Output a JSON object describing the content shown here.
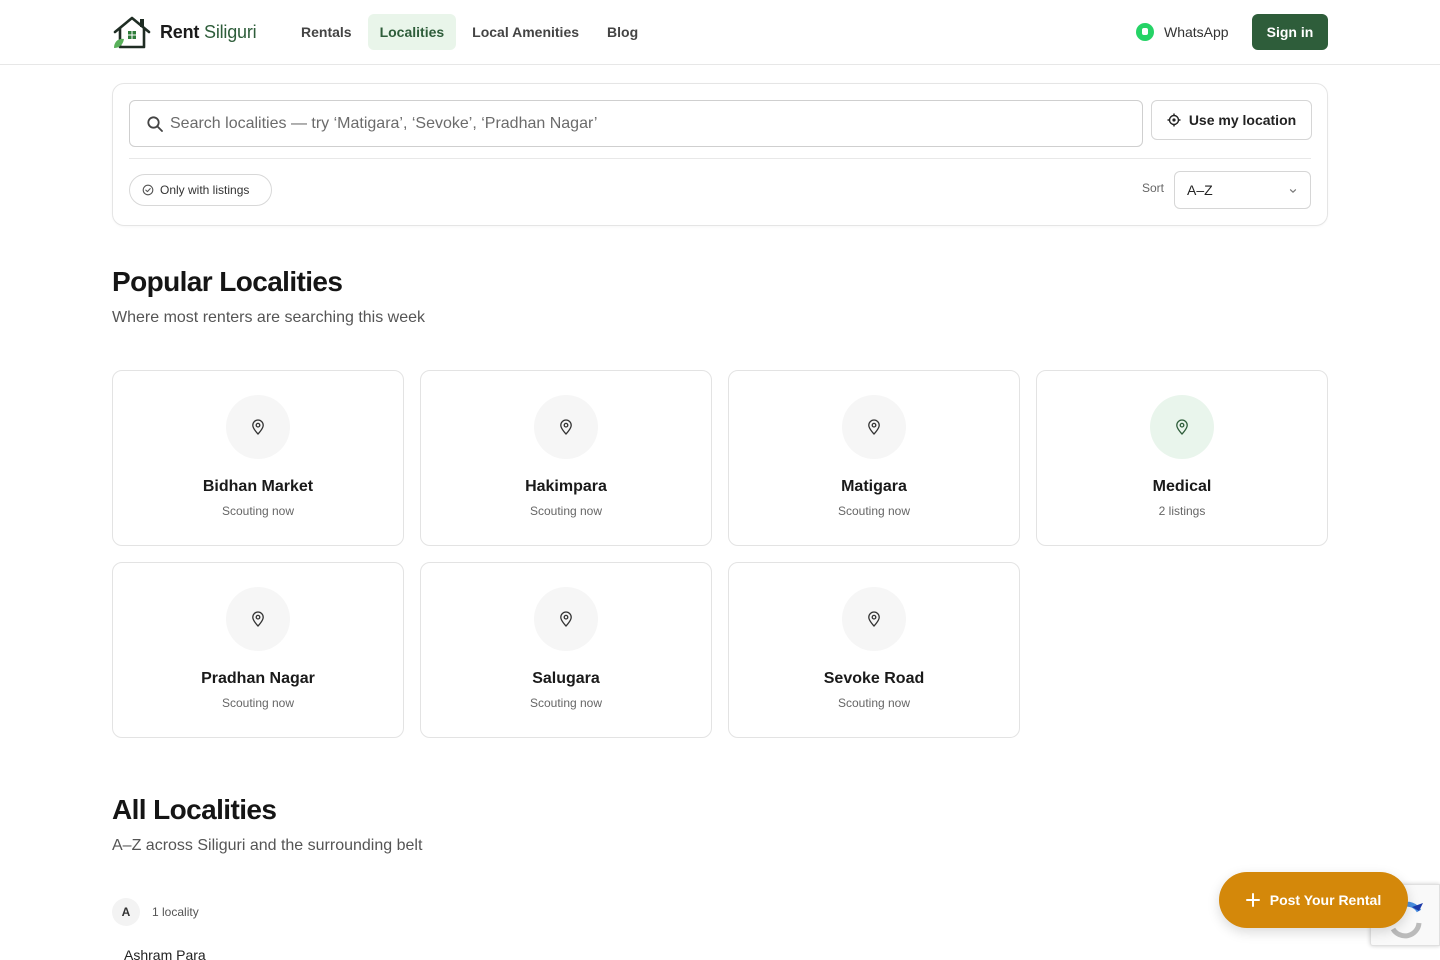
{
  "header": {
    "brand_main": "Rent",
    "brand_accent": "Siliguri",
    "nav": [
      {
        "label": "Rentals",
        "active": false
      },
      {
        "label": "Localities",
        "active": true
      },
      {
        "label": "Local Amenities",
        "active": false
      },
      {
        "label": "Blog",
        "active": false
      }
    ],
    "whatsapp_label": "WhatsApp",
    "signin_label": "Sign in"
  },
  "search": {
    "placeholder": "Search localities — try ‘Matigara’, ‘Sevoke’, ‘Pradhan Nagar’",
    "value": "",
    "location_button": "Use my location",
    "filter_chip": "Only with listings",
    "sort_label": "Sort",
    "sort_value": "A–Z"
  },
  "popular": {
    "title": "Popular Localities",
    "subtitle": "Where most renters are searching this week",
    "cards": [
      {
        "name": "Bidhan Market",
        "status": "Scouting now",
        "highlight": false
      },
      {
        "name": "Hakimpara",
        "status": "Scouting now",
        "highlight": false
      },
      {
        "name": "Matigara",
        "status": "Scouting now",
        "highlight": false
      },
      {
        "name": "Medical",
        "status": "2 listings",
        "highlight": true
      },
      {
        "name": "Pradhan Nagar",
        "status": "Scouting now",
        "highlight": false
      },
      {
        "name": "Salugara",
        "status": "Scouting now",
        "highlight": false
      },
      {
        "name": "Sevoke Road",
        "status": "Scouting now",
        "highlight": false
      }
    ]
  },
  "all": {
    "title": "All Localities",
    "subtitle": "A–Z across Siliguri and the surrounding belt",
    "groups": [
      {
        "letter": "A",
        "count": "1 locality",
        "items": [
          "Ashram Para"
        ]
      }
    ]
  },
  "fab": {
    "label": "Post Your Rental"
  },
  "colors": {
    "brand_green": "#2e5d3a",
    "active_bg": "#e9f5ea",
    "fab_orange": "#d4880a"
  }
}
